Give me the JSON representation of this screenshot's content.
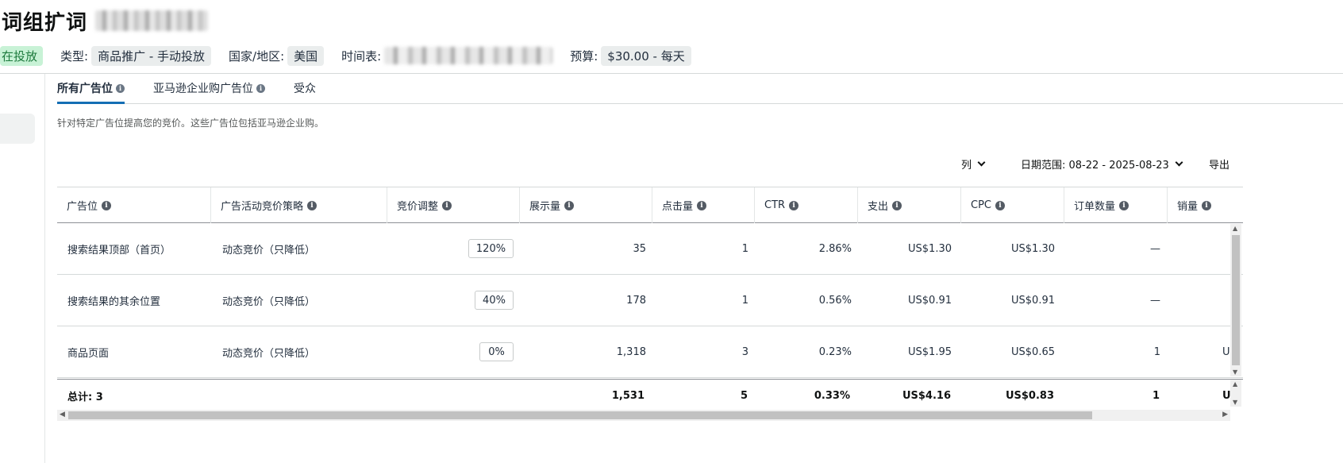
{
  "header": {
    "title": "词组扩词",
    "status": "在投放",
    "type_label": "类型:",
    "type_value": "商品推广 - 手动投放",
    "country_label": "国家/地区:",
    "country_value": "美国",
    "schedule_label": "时间表:",
    "budget_label": "预算:",
    "budget_value": "$30.00 - 每天"
  },
  "tabs": [
    {
      "label": "所有广告位",
      "active": true,
      "info": true
    },
    {
      "label": "亚马逊企业购广告位",
      "active": false,
      "info": true
    },
    {
      "label": "受众",
      "active": false,
      "info": false
    }
  ],
  "description": "针对特定广告位提高您的竞价。这些广告位包括亚马逊企业购。",
  "toolbar": {
    "columns_label": "列",
    "date_range_label": "日期范围: 08-22 - 2025-08-23",
    "export_label": "导出"
  },
  "table": {
    "columns": [
      "广告位",
      "广告活动竞价策略",
      "竞价调整",
      "展示量",
      "点击量",
      "CTR",
      "支出",
      "CPC",
      "订单数量",
      "销量"
    ],
    "rows": [
      {
        "placement": "搜索结果顶部（首页）",
        "strategy": "动态竞价（只降低）",
        "bid_adj": "120%",
        "impressions": "35",
        "clicks": "1",
        "ctr": "2.86%",
        "spend": "US$1.30",
        "cpc": "US$1.30",
        "orders": "—",
        "sales": ""
      },
      {
        "placement": "搜索结果的其余位置",
        "strategy": "动态竞价（只降低）",
        "bid_adj": "40%",
        "impressions": "178",
        "clicks": "1",
        "ctr": "0.56%",
        "spend": "US$0.91",
        "cpc": "US$0.91",
        "orders": "—",
        "sales": ""
      },
      {
        "placement": "商品页面",
        "strategy": "动态竞价（只降低）",
        "bid_adj": "0%",
        "impressions": "1,318",
        "clicks": "3",
        "ctr": "0.23%",
        "spend": "US$1.95",
        "cpc": "US$0.65",
        "orders": "1",
        "sales": "U"
      }
    ],
    "total": {
      "label": "总计: 3",
      "impressions": "1,531",
      "clicks": "5",
      "ctr": "0.33%",
      "spend": "US$4.16",
      "cpc": "US$0.83",
      "orders": "1",
      "sales": "U"
    }
  },
  "colors": {
    "accent": "#146eb4",
    "status_bg": "#c8f2d6",
    "status_fg": "#1d7a3d"
  }
}
